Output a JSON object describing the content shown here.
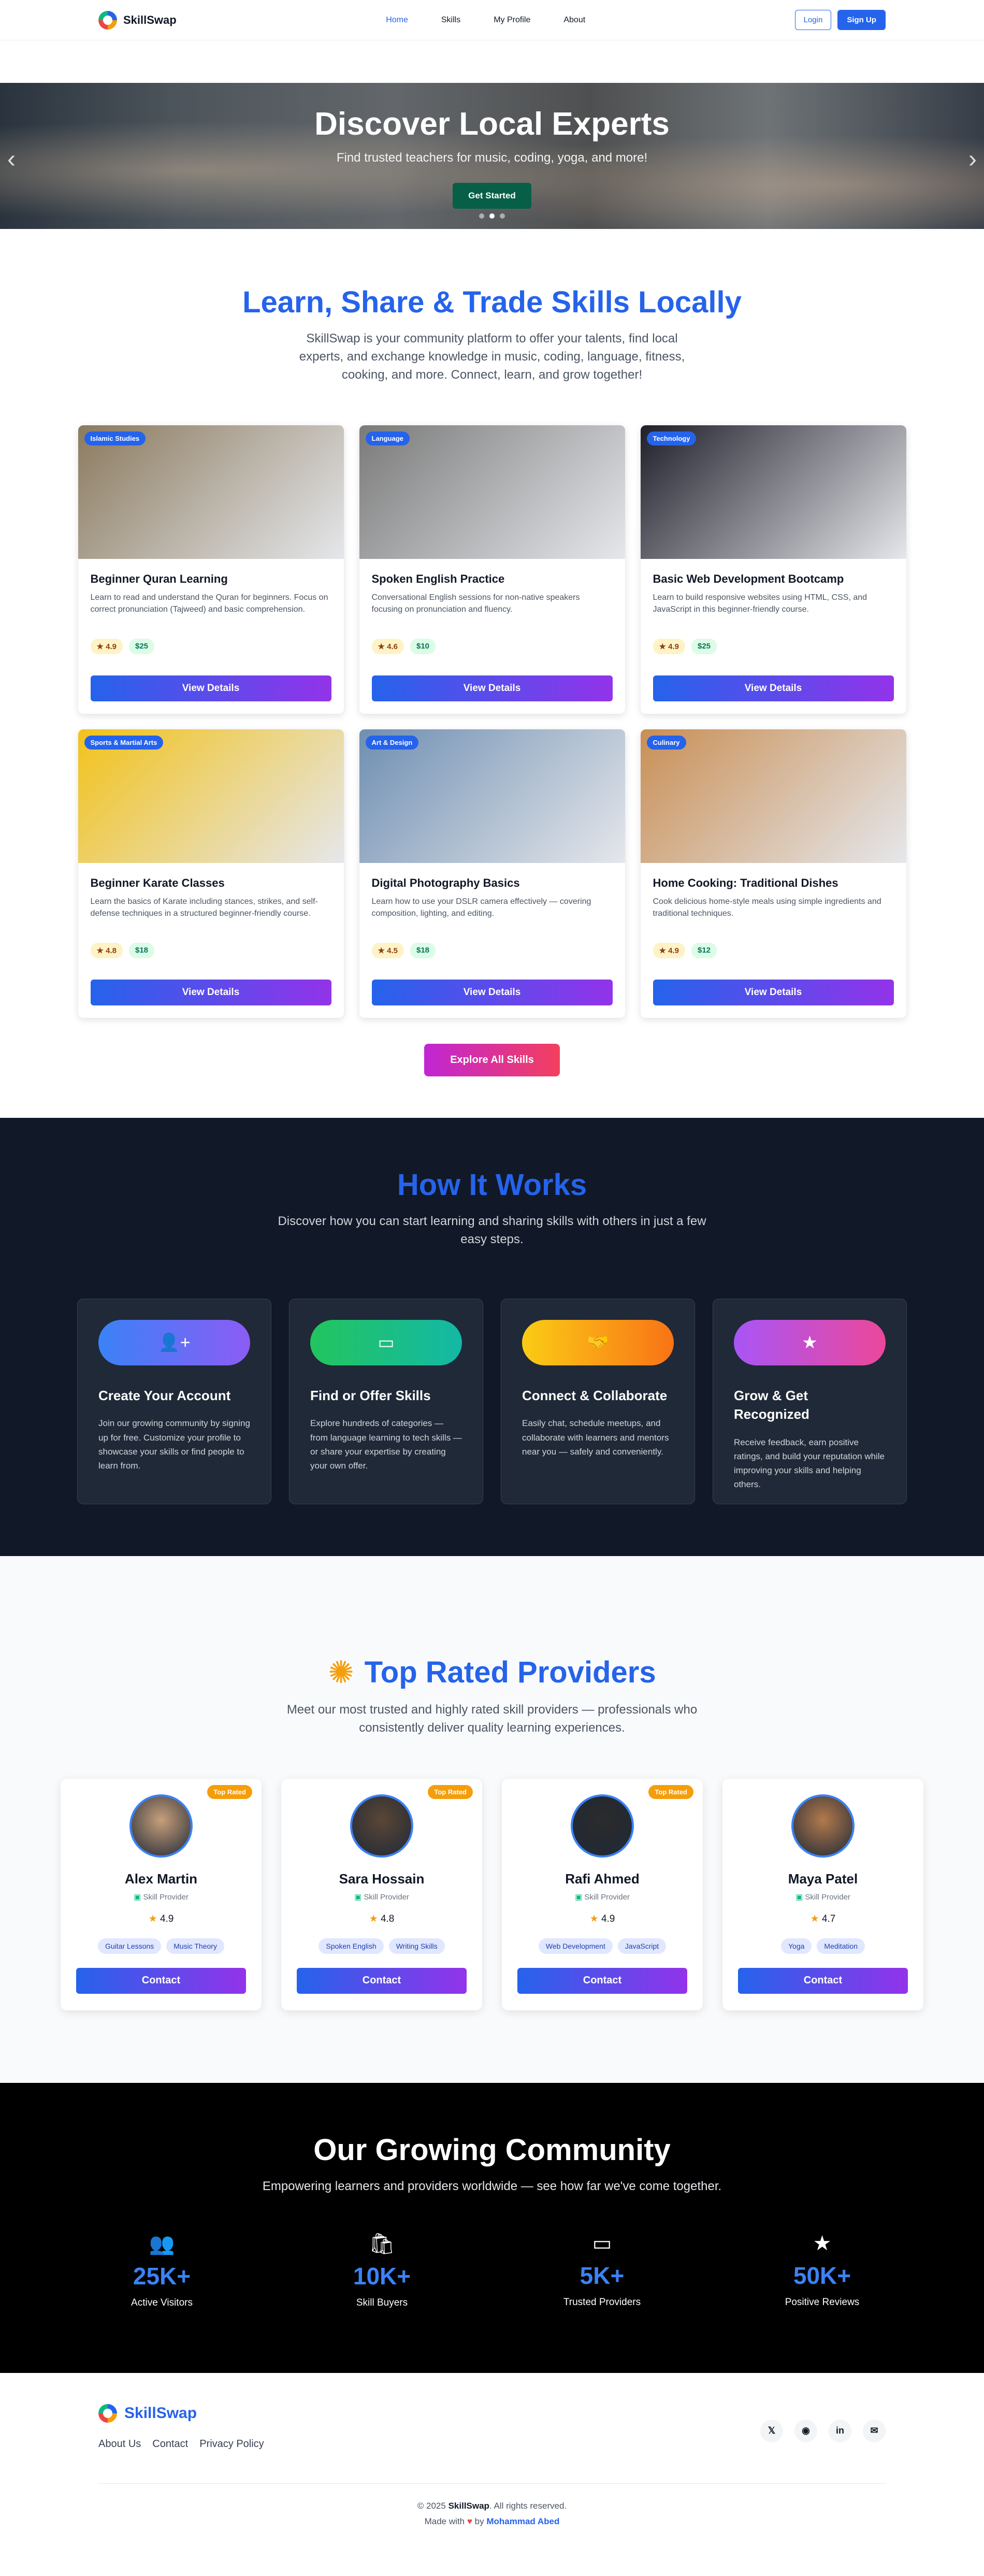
{
  "nav": {
    "brand": "SkillSwap",
    "links": [
      "Home",
      "Skills",
      "My Profile",
      "About"
    ],
    "login": "Login",
    "signup": "Sign Up"
  },
  "hero": {
    "title": "Discover Local Experts",
    "subtitle": "Find trusted teachers for music, coding, yoga, and more!",
    "cta": "Get Started"
  },
  "skills": {
    "title": "Learn, Share & Trade Skills Locally",
    "description": "SkillSwap is your community platform to offer your talents, find local experts, and exchange knowledge in music, coding, language, fitness, cooking, and more. Connect, learn, and grow together!",
    "button_label": "View Details",
    "explore": "Explore All Skills",
    "cards": [
      {
        "badge": "Islamic Studies",
        "title": "Beginner Quran Learning",
        "desc": "Learn to read and understand the Quran for beginners. Focus on correct pronunciation (Tajweed) and basic comprehension.",
        "rating": "4.9",
        "price": "$25",
        "img": "#8b7a5e"
      },
      {
        "badge": "Language",
        "title": "Spoken English Practice",
        "desc": "Conversational English sessions for non-native speakers focusing on pronunciation and fluency.",
        "rating": "4.6",
        "price": "$10",
        "img": "#7a7a7a"
      },
      {
        "badge": "Technology",
        "title": "Basic Web Development Bootcamp",
        "desc": "Learn to build responsive websites using HTML, CSS, and JavaScript in this beginner-friendly course.",
        "rating": "4.9",
        "price": "$25",
        "img": "#1f1f2a"
      },
      {
        "badge": "Sports & Martial Arts",
        "title": "Beginner Karate Classes",
        "desc": "Learn the basics of Karate including stances, strikes, and self-defense techniques in a structured beginner-friendly course.",
        "rating": "4.8",
        "price": "$18",
        "img": "#f2c21b"
      },
      {
        "badge": "Art & Design",
        "title": "Digital Photography Basics",
        "desc": "Learn how to use your DSLR camera effectively — covering composition, lighting, and editing.",
        "rating": "4.5",
        "price": "$18",
        "img": "#6f8fb2"
      },
      {
        "badge": "Culinary",
        "title": "Home Cooking: Traditional Dishes",
        "desc": "Cook delicious home-style meals using simple ingredients and traditional techniques.",
        "rating": "4.9",
        "price": "$12",
        "img": "#c98f55"
      }
    ]
  },
  "how": {
    "title": "How It Works",
    "description": "Discover how you can start learning and sharing skills with others in just a few easy steps.",
    "steps": [
      {
        "title": "Create Your Account",
        "desc": "Join our growing community by signing up for free. Customize your profile to showcase your skills or find people to learn from.",
        "icon": "add-user-icon",
        "gradient": "linear-gradient(90deg,#3b82f6,#8b5cf6)"
      },
      {
        "title": "Find or Offer Skills",
        "desc": "Explore hundreds of categories — from language learning to tech skills — or share your expertise by creating your own offer.",
        "icon": "teach-icon",
        "gradient": "linear-gradient(90deg,#22c55e,#14b8a6)"
      },
      {
        "title": "Connect & Collaborate",
        "desc": "Easily chat, schedule meetups, and collaborate with learners and mentors near you — safely and conveniently.",
        "icon": "handshake-icon",
        "gradient": "linear-gradient(90deg,#facc15,#f97316)"
      },
      {
        "title": "Grow & Get Recognized",
        "desc": "Receive feedback, earn positive ratings, and build your reputation while improving your skills and helping others.",
        "icon": "star-icon",
        "gradient": "linear-gradient(90deg,#a855f7,#ec4899)"
      }
    ]
  },
  "providers": {
    "title": "Top Rated Providers",
    "description": "Meet our most trusted and highly rated skill providers — professionals who consistently deliver quality learning experiences.",
    "role": "Skill Provider",
    "badge": "Top Rated",
    "contact": "Contact",
    "list": [
      {
        "name": "Alex Martin",
        "rating": "4.9",
        "tags": [
          "Guitar Lessons",
          "Music Theory"
        ],
        "top": true,
        "color": "#c89f7a"
      },
      {
        "name": "Sara Hossain",
        "rating": "4.8",
        "tags": [
          "Spoken English",
          "Writing Skills"
        ],
        "top": true,
        "color": "#5b4636"
      },
      {
        "name": "Rafi Ahmed",
        "rating": "4.9",
        "tags": [
          "Web Development",
          "JavaScript"
        ],
        "top": true,
        "color": "#2b2b2b"
      },
      {
        "name": "Maya Patel",
        "rating": "4.7",
        "tags": [
          "Yoga",
          "Meditation"
        ],
        "top": false,
        "color": "#b37a4c"
      }
    ]
  },
  "community": {
    "title": "Our Growing Community",
    "description": "Empowering learners and providers worldwide — see how far we've come together.",
    "stats": [
      {
        "value": "25K+",
        "label": "Active Visitors",
        "icon": "users-icon"
      },
      {
        "value": "10K+",
        "label": "Skill Buyers",
        "icon": "shopping-bag-icon"
      },
      {
        "value": "5K+",
        "label": "Trusted Providers",
        "icon": "teacher-icon"
      },
      {
        "value": "50K+",
        "label": "Positive Reviews",
        "icon": "star-icon"
      }
    ]
  },
  "footer": {
    "brand": "SkillSwap",
    "links": [
      "About Us",
      "Contact",
      "Privacy Policy"
    ],
    "socials": [
      "twitter-icon",
      "github-icon",
      "linkedin-icon",
      "mail-icon"
    ],
    "copyright_prefix": "© 2025",
    "copyright_brand": "SkillSwap",
    "copyright_suffix": ". All rights reserved.",
    "made_with": "Made with",
    "by": "by",
    "author": "Mohammad Abed"
  }
}
